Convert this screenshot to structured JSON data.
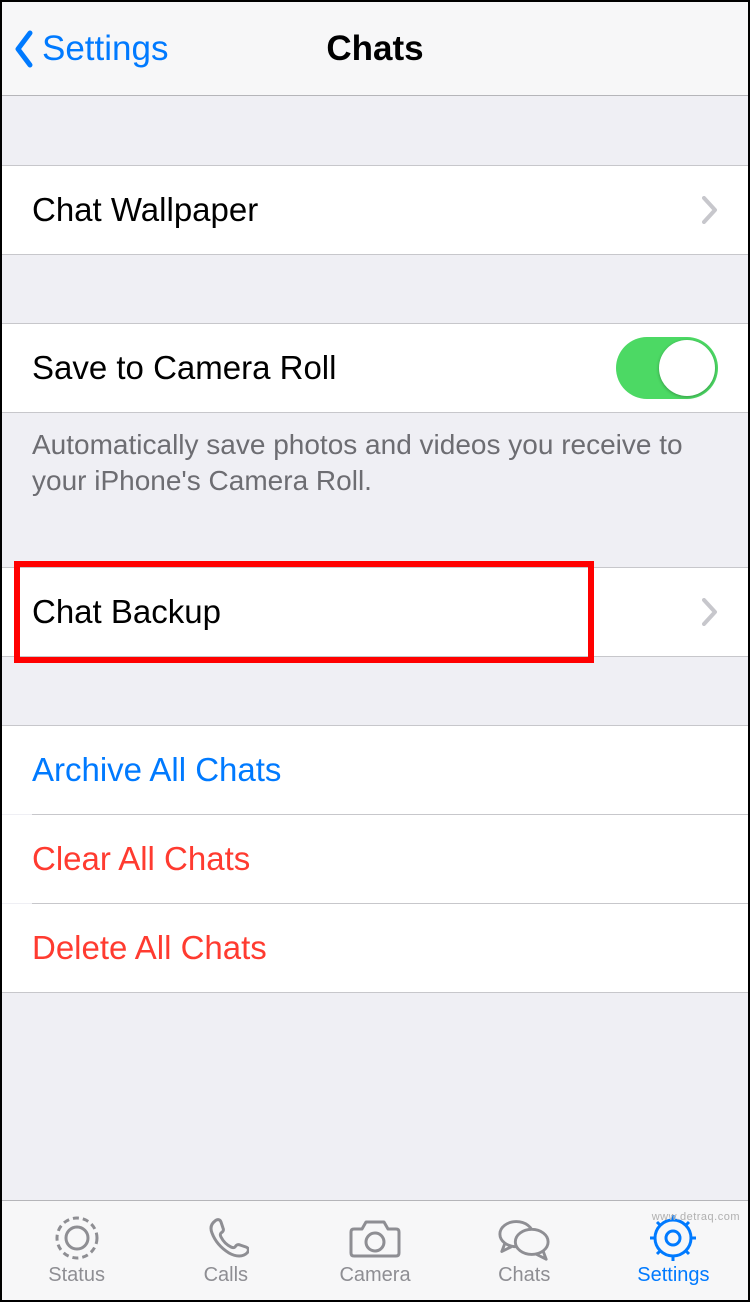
{
  "navbar": {
    "back_label": "Settings",
    "title": "Chats"
  },
  "rows": {
    "wallpaper": "Chat Wallpaper",
    "save_camera_roll": "Save to Camera Roll",
    "backup": "Chat Backup",
    "archive": "Archive All Chats",
    "clear": "Clear All Chats",
    "delete": "Delete All Chats"
  },
  "footer_save_camera": "Automatically save photos and videos you receive to your iPhone's Camera Roll.",
  "save_camera_roll_on": true,
  "tabs": {
    "status": "Status",
    "calls": "Calls",
    "camera": "Camera",
    "chats": "Chats",
    "settings": "Settings"
  },
  "active_tab": "settings",
  "watermark": "www.detraq.com"
}
